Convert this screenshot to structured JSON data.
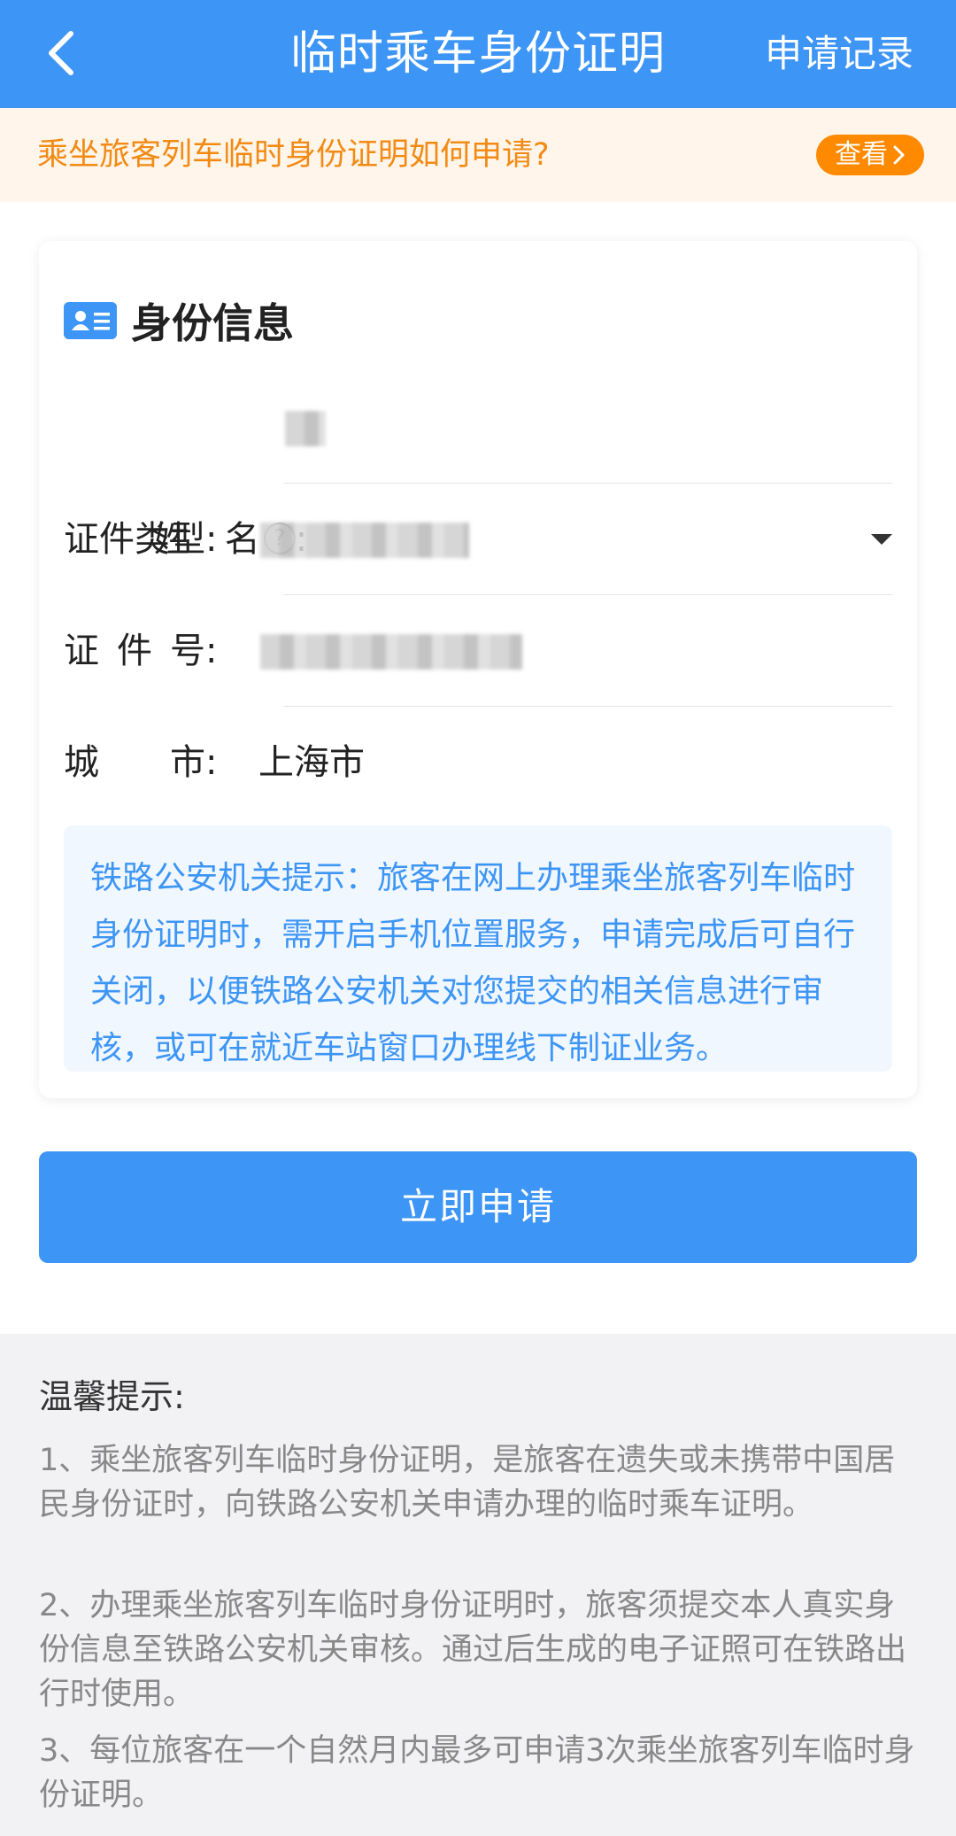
{
  "header": {
    "title": "临时乘车身份证明",
    "records_label": "申请记录"
  },
  "notice": {
    "text": "乘坐旅客列车临时身份证明如何申请?",
    "view_label": "查看"
  },
  "card": {
    "title": "身份信息",
    "fields": [
      {
        "label": "姓　名",
        "value": ""
      },
      {
        "label": "证件类型:",
        "value": ""
      },
      {
        "label": "证 件 号:",
        "value": ""
      },
      {
        "label": "城　　市:",
        "value": "上海市"
      }
    ],
    "tip": "铁路公安机关提示：旅客在网上办理乘坐旅客列车临时身份证明时，需开启手机位置服务，申请完成后可自行关闭，以便铁路公安机关对您提交的相关信息进行审核，或可在就近车站窗口办理线下制证业务。"
  },
  "apply_button_label": "立即申请",
  "tips": {
    "title": "温馨提示:",
    "items": [
      "1、乘坐旅客列车临时身份证明，是旅客在遗失或未携带中国居民身份证时，向铁路公安机关申请办理的临时乘车证明。",
      "2、办理乘坐旅客列车临时身份证明时，旅客须提交本人真实身份信息至铁路公安机关审核。通过后生成的电子证照可在铁路出行时使用。",
      "3、每位旅客在一个自然月内最多可申请3次乘坐旅客列车临时身份证明。"
    ]
  },
  "colors": {
    "primary": "#3d95f5",
    "notice_bg": "#fff5ea",
    "notice_text": "#f28a14",
    "view_btn": "#ff8a00"
  },
  "icons": {
    "back": "chevron-left-icon",
    "help": "question-circle-icon",
    "id_card": "id-card-icon",
    "dropdown": "caret-down-icon",
    "view_arrow": "chevron-right-icon"
  }
}
